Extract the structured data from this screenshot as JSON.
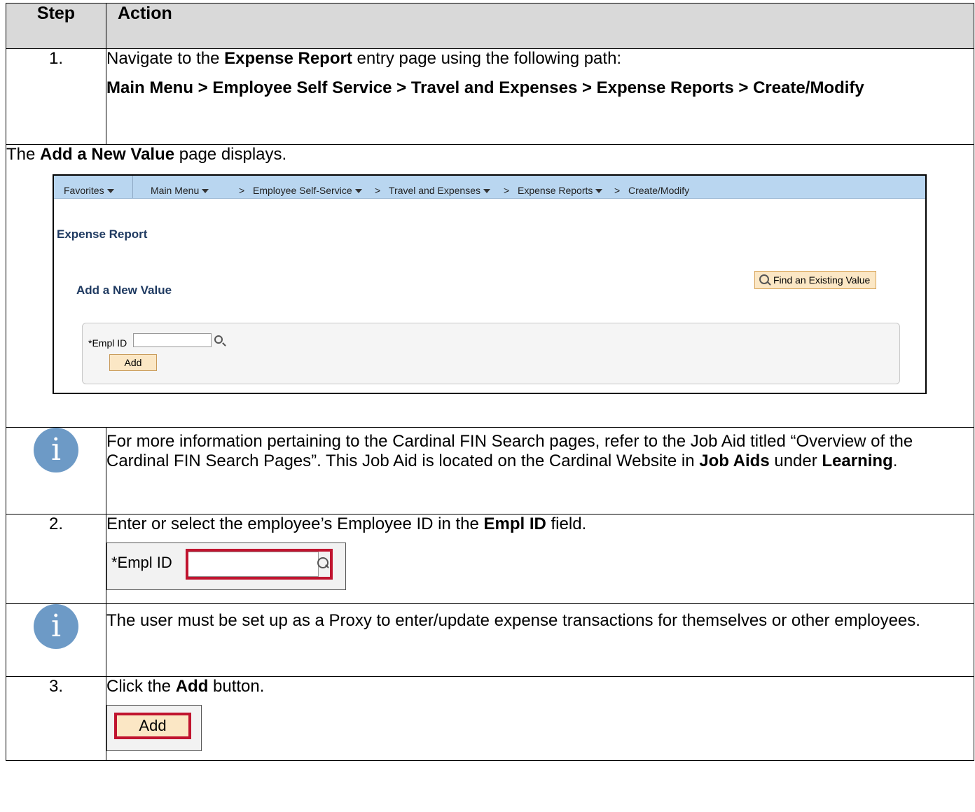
{
  "header": {
    "step": "Step",
    "action": "Action"
  },
  "row1": {
    "num": "1.",
    "line1_pre": "Navigate to the ",
    "line1_bold": "Expense Report",
    "line1_post": " entry page using the following path:",
    "path": "Main Menu > Employee Self Service > Travel and Expenses > Expense Reports > Create/Modify"
  },
  "note1": {
    "pre": "The ",
    "bold": "Add a New Value",
    "post": " page displays."
  },
  "screenshot": {
    "nav": {
      "favorites": "Favorites",
      "main_menu": "Main Menu",
      "self_service": "Employee Self-Service",
      "travel": "Travel and Expenses",
      "expense_reports": "Expense Reports",
      "create": "Create/Modify",
      "chevron": ">"
    },
    "title": "Expense Report",
    "subtitle": "Add a New Value",
    "find_button": "Find an Existing Value",
    "empl_label": "*Empl ID",
    "add_button": "Add"
  },
  "info1": {
    "icon": "info-icon",
    "text1": "For more information pertaining to the Cardinal FIN Search pages, refer to the Job Aid titled “Overview of the Cardinal FIN Search Pages”.  This Job Aid is located on the Cardinal Website in ",
    "bold1": "Job Aids",
    "mid": " under ",
    "bold2": "Learning",
    "end": "."
  },
  "row2": {
    "num": "2.",
    "pre": "Enter or select the employee’s Employee ID in the ",
    "bold": "Empl ID",
    "post": " field.",
    "crop_label": "*Empl ID"
  },
  "info2": {
    "icon": "info-icon",
    "text": "The user must be set up as a Proxy to enter/update expense transactions for themselves or other employees."
  },
  "row3": {
    "num": "3.",
    "pre": "Click the ",
    "bold": "Add",
    "post": " button.",
    "crop_button": "Add"
  },
  "colors": {
    "header_bg": "#d9d9d9",
    "info_icon": "#6d9ac6",
    "nav_bg": "#b9d6f0",
    "highlight": "#c0142f",
    "button_bg": "#fbe7c5"
  }
}
